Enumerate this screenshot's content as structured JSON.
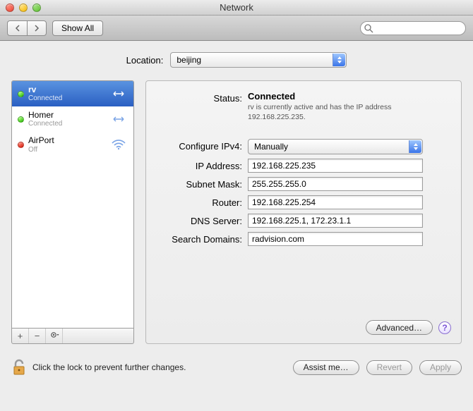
{
  "window": {
    "title": "Network"
  },
  "toolbar": {
    "show_all": "Show All",
    "search_placeholder": ""
  },
  "location": {
    "label": "Location:",
    "value": "beijing"
  },
  "sidebar": {
    "items": [
      {
        "name": "rv",
        "sub": "Connected",
        "dot": "green",
        "selected": true,
        "icon": "link"
      },
      {
        "name": "Homer",
        "sub": "Connected",
        "dot": "green",
        "selected": false,
        "icon": "link"
      },
      {
        "name": "AirPort",
        "sub": "Off",
        "dot": "red",
        "selected": false,
        "icon": "wifi"
      }
    ],
    "footer_buttons": {
      "add": "+",
      "remove": "−",
      "gear": "⚙"
    }
  },
  "details": {
    "status_label": "Status:",
    "status_value": "Connected",
    "status_sub": "rv is currently active and has the IP address 192.168.225.235.",
    "config_label": "Configure IPv4:",
    "config_value": "Manually",
    "fields": {
      "ip": {
        "label": "IP Address:",
        "value": "192.168.225.235"
      },
      "mask": {
        "label": "Subnet Mask:",
        "value": "255.255.255.0"
      },
      "router": {
        "label": "Router:",
        "value": "192.168.225.254"
      },
      "dns": {
        "label": "DNS Server:",
        "value": "192.168.225.1, 172.23.1.1"
      },
      "search": {
        "label": "Search Domains:",
        "value": "radvision.com"
      }
    },
    "advanced": "Advanced…"
  },
  "footer": {
    "lock_text": "Click the lock to prevent further changes.",
    "assist": "Assist me…",
    "revert": "Revert",
    "apply": "Apply"
  }
}
